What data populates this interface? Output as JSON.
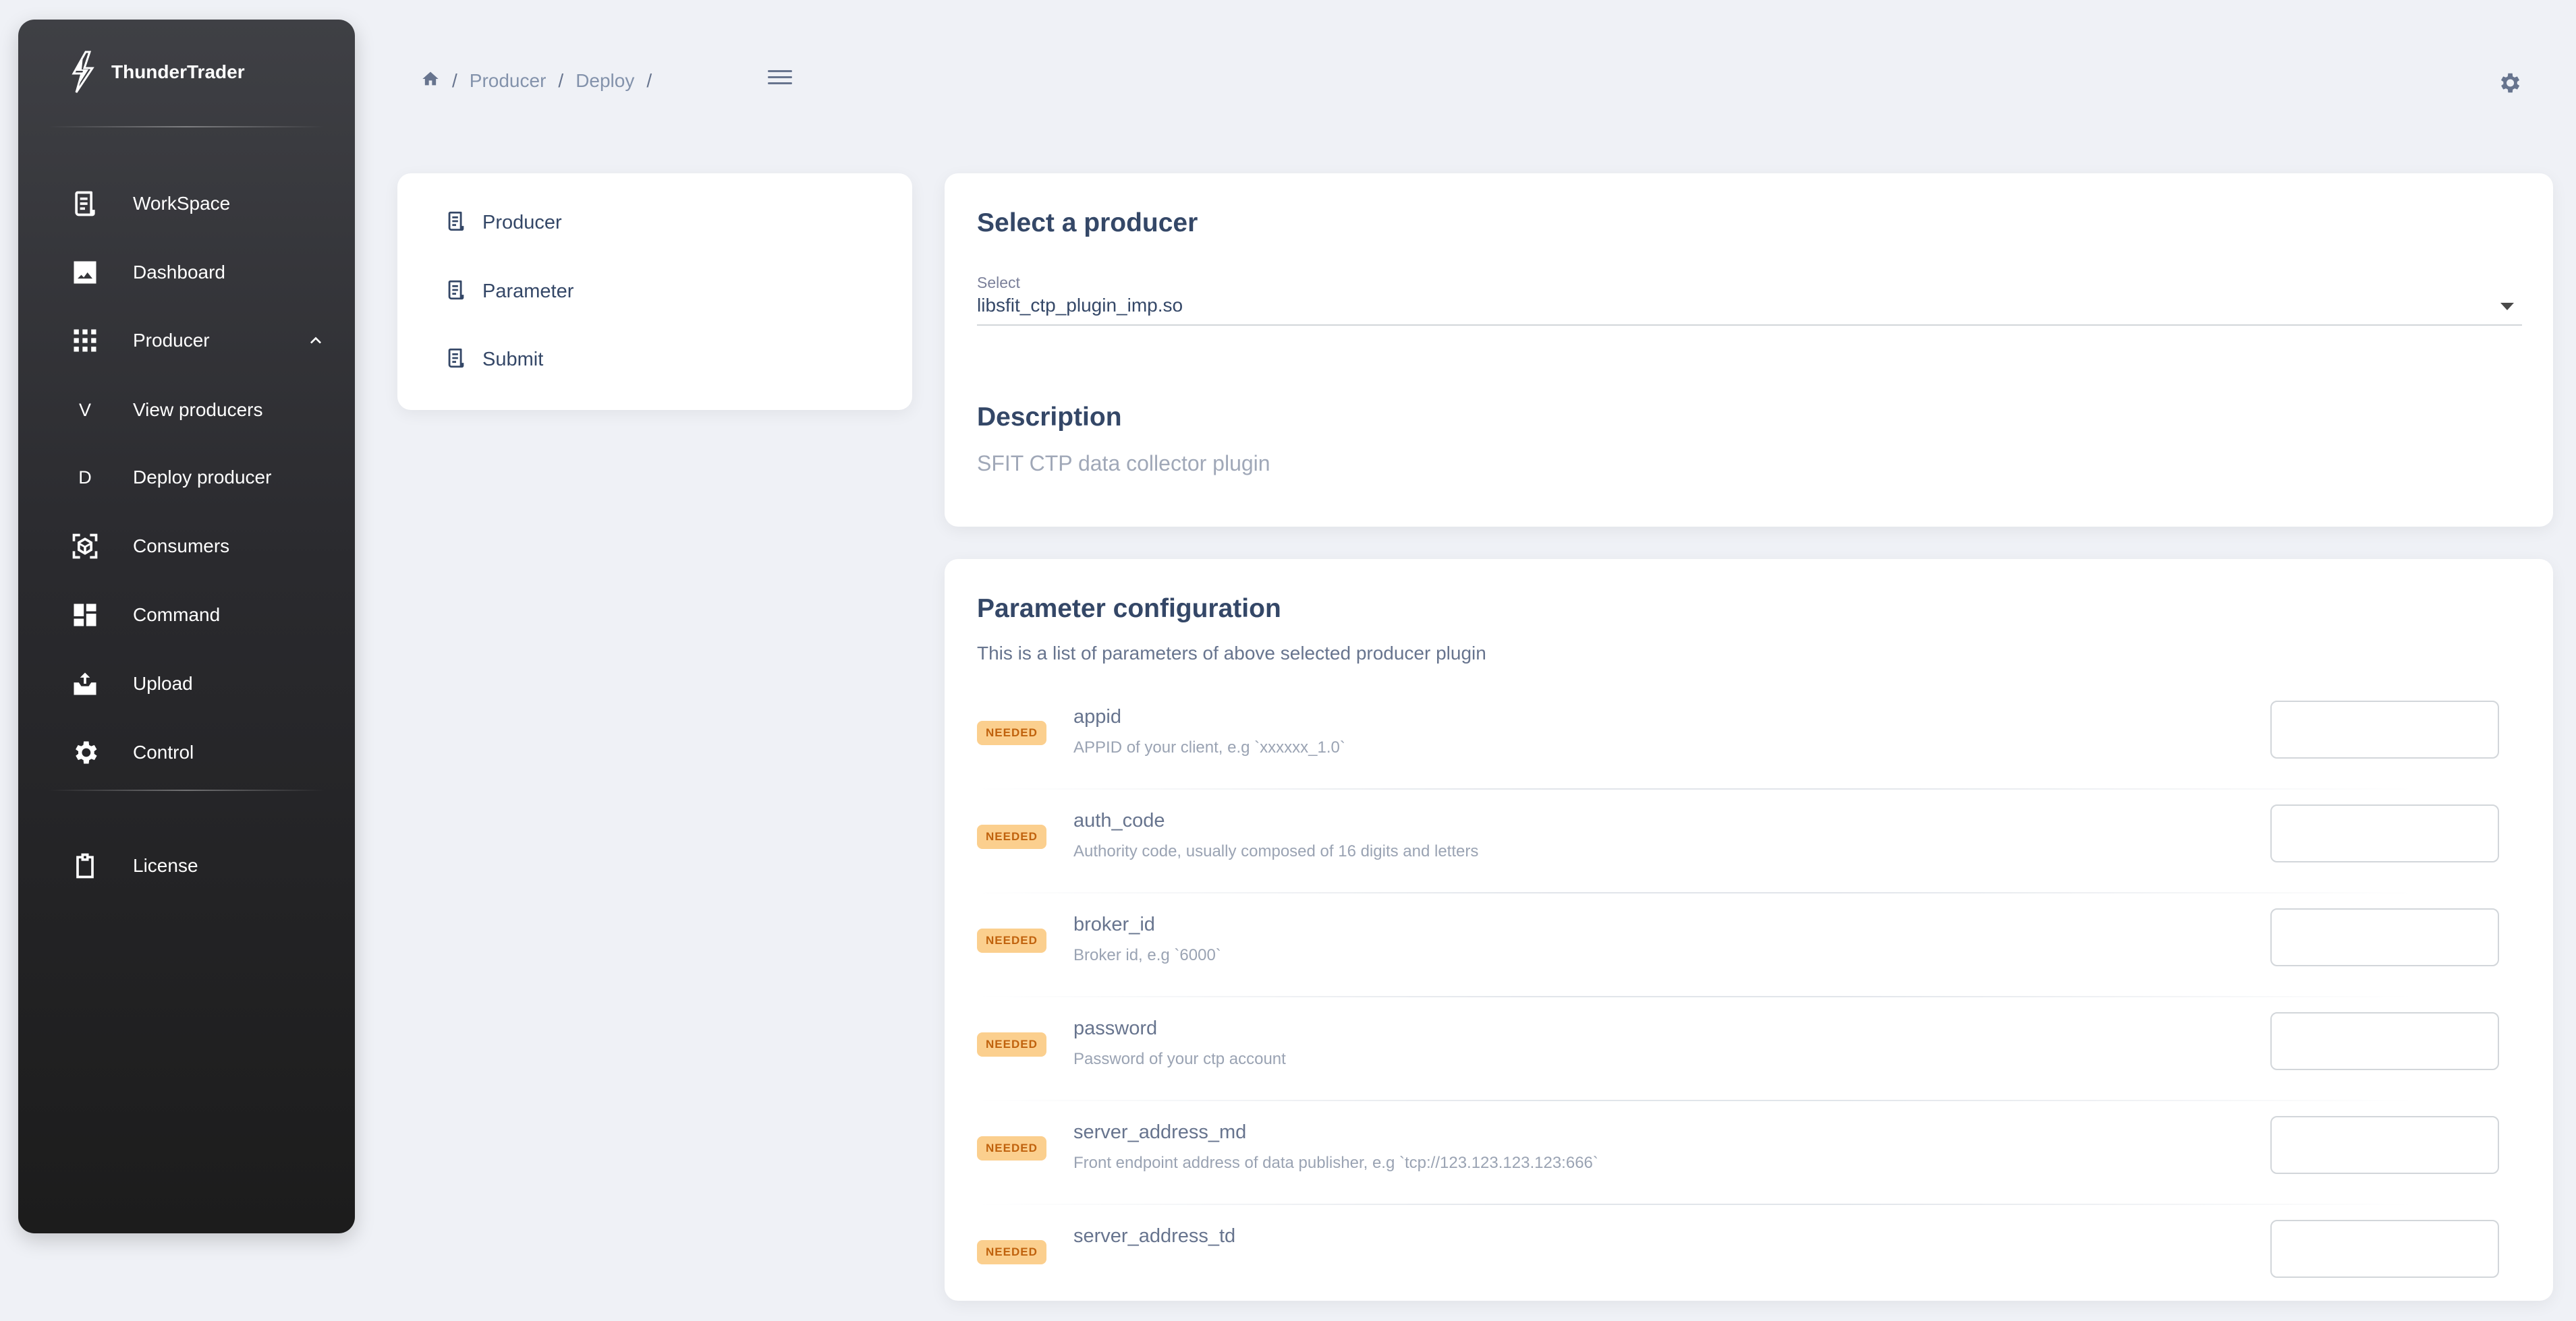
{
  "app": {
    "name": "ThunderTrader"
  },
  "sidebar": {
    "items": [
      {
        "label": "WorkSpace",
        "icon": "workspace-icon"
      },
      {
        "label": "Dashboard",
        "icon": "image-icon"
      },
      {
        "label": "Producer",
        "icon": "apps-grid-icon",
        "expanded": true
      },
      {
        "label": "View producers",
        "letter": "V"
      },
      {
        "label": "Deploy producer",
        "letter": "D"
      },
      {
        "label": "Consumers",
        "icon": "cube-scan-icon"
      },
      {
        "label": "Command",
        "icon": "dashboard-tiles-icon"
      },
      {
        "label": "Upload",
        "icon": "inbox-upload-icon"
      },
      {
        "label": "Control",
        "icon": "gear-icon"
      },
      {
        "label": "License",
        "icon": "clipboard-icon"
      }
    ]
  },
  "breadcrumb": {
    "items": [
      "Producer",
      "Deploy"
    ]
  },
  "steps": [
    "Producer",
    "Parameter",
    "Submit"
  ],
  "producer": {
    "title": "Select a producer",
    "select_label": "Select",
    "select_value": "libsfit_ctp_plugin_imp.so",
    "description_title": "Description",
    "description": "SFIT CTP data collector plugin"
  },
  "parameters": {
    "title": "Parameter configuration",
    "subtitle": "This is a list of parameters of above selected producer plugin",
    "items": [
      {
        "badge": "NEEDED",
        "name": "appid",
        "desc": "APPID of your client, e.g `xxxxxx_1.0`"
      },
      {
        "badge": "NEEDED",
        "name": "auth_code",
        "desc": "Authority code, usually composed of 16 digits and letters"
      },
      {
        "badge": "NEEDED",
        "name": "broker_id",
        "desc": "Broker id, e.g `6000`"
      },
      {
        "badge": "NEEDED",
        "name": "password",
        "desc": "Password of your ctp account"
      },
      {
        "badge": "NEEDED",
        "name": "server_address_md",
        "desc": "Front endpoint address of data publisher, e.g `tcp://123.123.123.123:666`"
      },
      {
        "badge": "NEEDED",
        "name": "server_address_td",
        "desc": ""
      }
    ]
  },
  "colors": {
    "badge_bg": "#fbcf8e",
    "badge_text": "#c0620d",
    "sidebar_top": "#3f4045",
    "sidebar_bottom": "#1c1c1c"
  }
}
